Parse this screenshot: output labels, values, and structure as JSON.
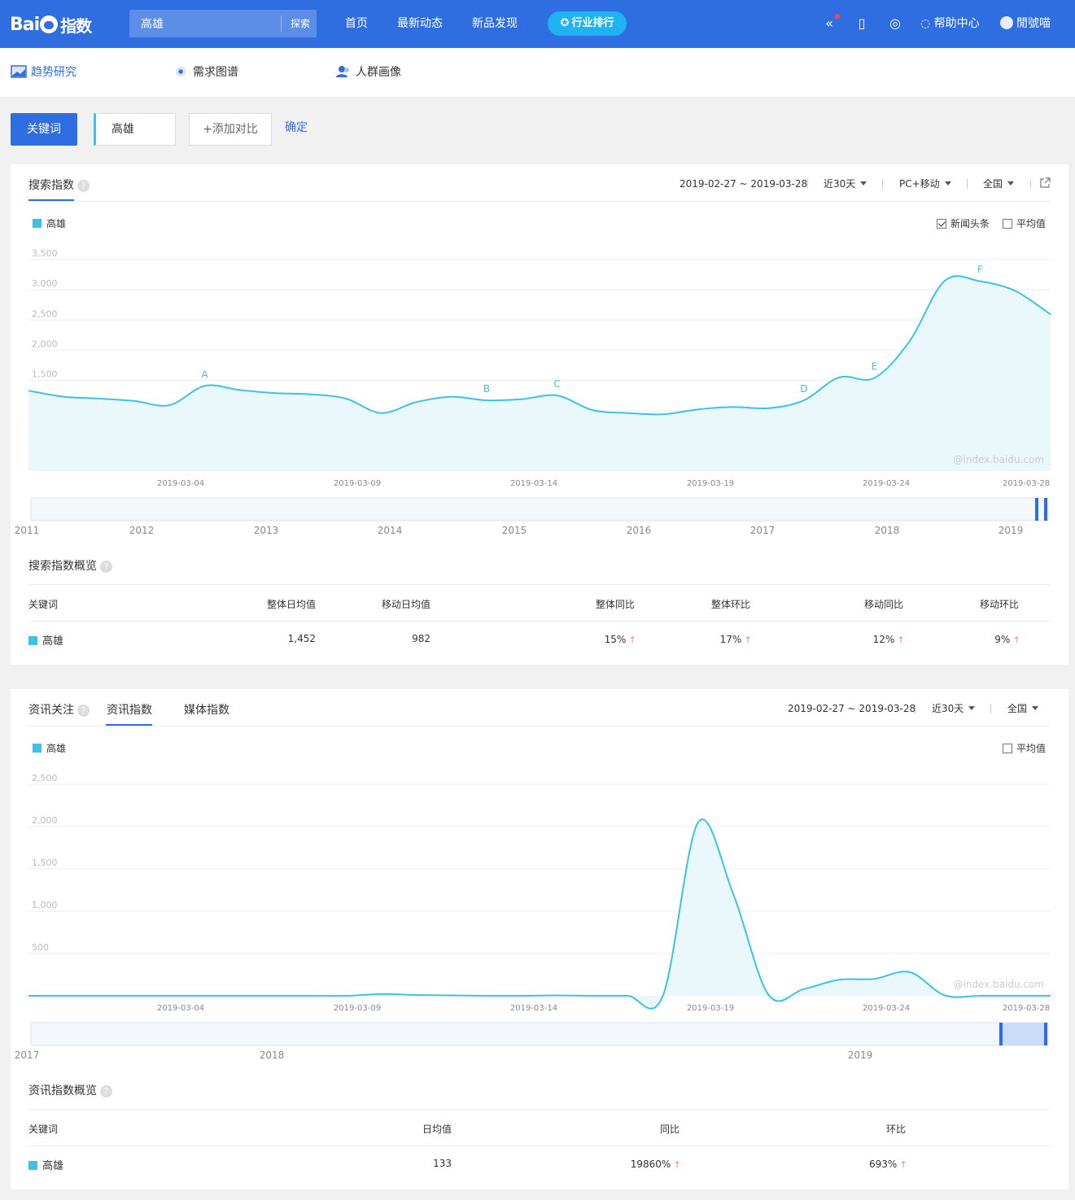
{
  "brand": {
    "logo_en": "Bai",
    "logo_du": "du",
    "logo_cn": "指数"
  },
  "search": {
    "value": "高雄",
    "button": "探索"
  },
  "nav": {
    "home": "首页",
    "news": "最新动态",
    "newprod": "新品发现",
    "rank": "行业排行"
  },
  "topbar": {
    "help": "帮助中心",
    "user": "閒號喵"
  },
  "subnav": {
    "trend": "趋势研究",
    "demand": "需求图谱",
    "crowd": "人群画像"
  },
  "keyword_bar": {
    "label": "关键词",
    "keyword": "高雄",
    "add": "+添加对比",
    "confirm": "确定"
  },
  "search_index": {
    "title": "搜索指数",
    "help": "?",
    "date_range": "2019-02-27 ~ 2019-03-28",
    "period": "近30天",
    "device": "PC+移动",
    "region": "全国",
    "legend": "高雄",
    "headline_checkbox": "新闻头条",
    "headline_checked": true,
    "avg_checkbox": "平均值",
    "avg_checked": false,
    "watermark": "@index.baidu.com",
    "overview_title": "搜索指数概览",
    "table_headers": [
      "关键词",
      "整体日均值",
      "移动日均值",
      "整体同比",
      "整体环比",
      "移动同比",
      "移动环比"
    ],
    "table_row": {
      "keyword": "高雄",
      "overall_avg": "1,452",
      "mobile_avg": "982",
      "overall_yoy": "15%",
      "overall_mom": "17%",
      "mobile_yoy": "12%",
      "mobile_mom": "9%"
    },
    "timeline_years": [
      "2011",
      "2012",
      "2013",
      "2014",
      "2015",
      "2016",
      "2017",
      "2018",
      "2019"
    ]
  },
  "news_index": {
    "title": "资讯关注",
    "help": "?",
    "tabs": [
      "资讯指数",
      "媒体指数"
    ],
    "date_range": "2019-02-27 ~ 2019-03-28",
    "period": "近30天",
    "region": "全国",
    "legend": "高雄",
    "avg_checkbox": "平均值",
    "avg_checked": false,
    "watermark": "@index.baidu.com",
    "overview_title": "资讯指数概览",
    "table_headers": [
      "关键词",
      "日均值",
      "同比",
      "环比"
    ],
    "table_row": {
      "keyword": "高雄",
      "avg": "133",
      "yoy": "19860%",
      "mom": "693%"
    },
    "timeline_years": [
      "2017",
      "2018",
      "2019"
    ]
  },
  "colors": {
    "brand_blue": "#2f6ee0",
    "series": "#3ec1e6",
    "up_arrow": "#f05c3a",
    "hot_tab": "#1fb3f2"
  },
  "chart_data": [
    {
      "type": "area",
      "name": "search_index",
      "x": [
        "2019-02-27",
        "2019-02-28",
        "2019-03-01",
        "2019-03-02",
        "2019-03-03",
        "2019-03-04",
        "2019-03-05",
        "2019-03-06",
        "2019-03-07",
        "2019-03-08",
        "2019-03-09",
        "2019-03-10",
        "2019-03-11",
        "2019-03-12",
        "2019-03-13",
        "2019-03-14",
        "2019-03-15",
        "2019-03-16",
        "2019-03-17",
        "2019-03-18",
        "2019-03-19",
        "2019-03-20",
        "2019-03-21",
        "2019-03-22",
        "2019-03-23",
        "2019-03-24",
        "2019-03-25",
        "2019-03-26",
        "2019-03-27",
        "2019-03-28"
      ],
      "x_tick_labels": [
        "2019-03-04",
        "2019-03-09",
        "2019-03-14",
        "2019-03-19",
        "2019-03-24",
        "2019-03-28"
      ],
      "series": [
        {
          "name": "高雄",
          "values": [
            1330,
            1230,
            1200,
            1160,
            1090,
            1410,
            1340,
            1290,
            1270,
            1200,
            960,
            1140,
            1230,
            1170,
            1190,
            1250,
            1010,
            960,
            940,
            1020,
            1060,
            1040,
            1170,
            1550,
            1540,
            2150,
            3150,
            3140,
            2980,
            2590
          ]
        }
      ],
      "y_ticks": [
        500,
        1000,
        1500,
        2000,
        2500,
        3000,
        3500
      ],
      "y_tick_labels": [
        "500",
        "1,000",
        "1,500",
        "2,000",
        "2,500",
        "3,000",
        "3,500"
      ],
      "ylim": [
        0,
        3500
      ],
      "annotations": [
        {
          "label": "A",
          "x": "2019-03-04"
        },
        {
          "label": "B",
          "x": "2019-03-12"
        },
        {
          "label": "C",
          "x": "2019-03-14"
        },
        {
          "label": "D",
          "x": "2019-03-21"
        },
        {
          "label": "E",
          "x": "2019-03-23"
        },
        {
          "label": "F",
          "x": "2019-03-26"
        }
      ],
      "grid": true,
      "legend": "top-left"
    },
    {
      "type": "area",
      "name": "news_index",
      "x": [
        "2019-02-27",
        "2019-02-28",
        "2019-03-01",
        "2019-03-02",
        "2019-03-03",
        "2019-03-04",
        "2019-03-05",
        "2019-03-06",
        "2019-03-07",
        "2019-03-08",
        "2019-03-09",
        "2019-03-10",
        "2019-03-11",
        "2019-03-12",
        "2019-03-13",
        "2019-03-14",
        "2019-03-15",
        "2019-03-16",
        "2019-03-17",
        "2019-03-18",
        "2019-03-19",
        "2019-03-20",
        "2019-03-21",
        "2019-03-22",
        "2019-03-23",
        "2019-03-24",
        "2019-03-25",
        "2019-03-26",
        "2019-03-27",
        "2019-03-28"
      ],
      "x_tick_labels": [
        "2019-03-04",
        "2019-03-09",
        "2019-03-14",
        "2019-03-19",
        "2019-03-24",
        "2019-03-28"
      ],
      "series": [
        {
          "name": "高雄",
          "values": [
            0,
            0,
            0,
            0,
            0,
            0,
            0,
            0,
            0,
            0,
            20,
            10,
            5,
            0,
            0,
            5,
            0,
            0,
            0,
            2050,
            1200,
            10,
            80,
            190,
            200,
            280,
            5,
            0,
            0,
            0
          ]
        }
      ],
      "y_ticks": [
        500,
        1000,
        1500,
        2000,
        2500
      ],
      "y_tick_labels": [
        "500",
        "1,000",
        "1,500",
        "2,000",
        "2,500"
      ],
      "ylim": [
        0,
        2500
      ],
      "grid": true,
      "legend": "top-left"
    }
  ]
}
